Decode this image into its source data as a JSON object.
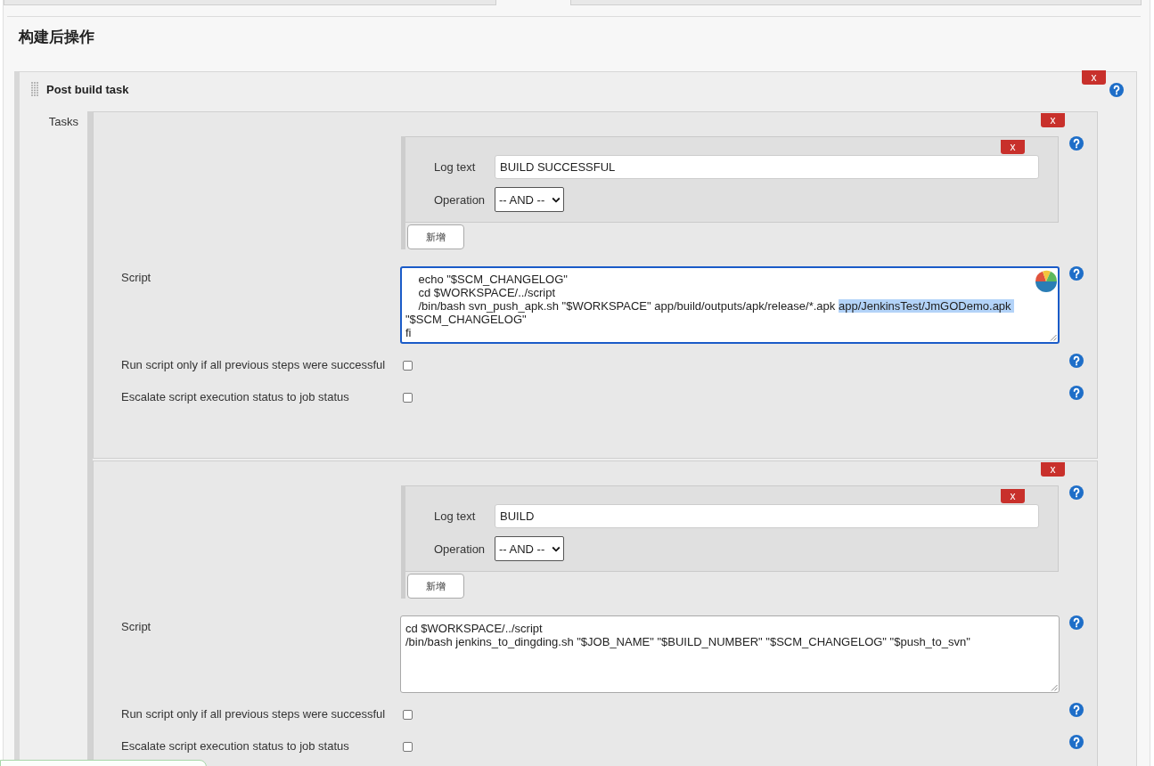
{
  "heading": "构建后操作",
  "post_build_task": {
    "title": "Post build task",
    "delete_label": "x",
    "tasks_label": "Tasks",
    "tasks": [
      {
        "delete_label": "x",
        "log_texts": [
          {
            "delete_label": "x",
            "label": "Log text",
            "value": "BUILD SUCCESSFUL",
            "operation_label": "Operation",
            "operation": "-- AND --"
          }
        ],
        "add_button": "新增",
        "script_label": "Script",
        "script": {
          "focused": true,
          "segments": [
            {
              "text": "    echo \"$SCM_CHANGELOG\"\n    cd $WORKSPACE/../script\n    /bin/bash svn_push_apk.sh \"$WORKSPACE\" app/build/outputs/apk/release/*.apk ",
              "selected": false
            },
            {
              "text": "app/JenkinsTest/JmGODemo.apk ",
              "selected": true
            },
            {
              "text": "\"$SCM_CHANGELOG\"\nfi",
              "selected": false
            }
          ]
        },
        "options": [
          {
            "label": "Run script only if all previous steps were successful",
            "checked": false
          },
          {
            "label": "Escalate script execution status to job status",
            "checked": false
          }
        ]
      },
      {
        "delete_label": "x",
        "log_texts": [
          {
            "delete_label": "x",
            "label": "Log text",
            "value": "BUILD",
            "operation_label": "Operation",
            "operation": "-- AND --"
          }
        ],
        "add_button": "新增",
        "script_label": "Script",
        "script": {
          "focused": false,
          "segments": [
            {
              "text": "cd $WORKSPACE/../script\n/bin/bash jenkins_to_dingding.sh \"$JOB_NAME\" \"$BUILD_NUMBER\" \"$SCM_CHANGELOG\" \"$push_to_svn\"",
              "selected": false
            }
          ]
        },
        "options": [
          {
            "label": "Run script only if all previous steps were successful",
            "checked": false
          },
          {
            "label": "Escalate script execution status to job status",
            "checked": false
          }
        ]
      }
    ]
  }
}
